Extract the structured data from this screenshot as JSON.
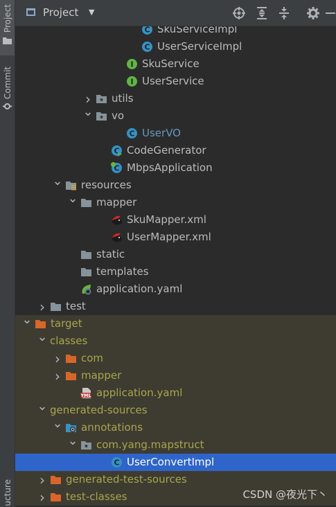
{
  "sidebar": {
    "project_label": "Project",
    "commit_label": "Commit",
    "structure_label": "ucture"
  },
  "header": {
    "title": "Project"
  },
  "tree": [
    {
      "label": "SkuServiceImpl",
      "icon": "class-icon",
      "style": "normal"
    },
    {
      "label": "UserServiceImpl",
      "icon": "class-icon",
      "style": "normal"
    },
    {
      "label": "SkuService",
      "icon": "interface-icon",
      "style": "normal"
    },
    {
      "label": "UserService",
      "icon": "interface-icon",
      "style": "normal"
    },
    {
      "label": "utils",
      "icon": "package-folder-icon",
      "style": "normal",
      "expanded": false
    },
    {
      "label": "vo",
      "icon": "package-folder-icon",
      "style": "normal",
      "expanded": true
    },
    {
      "label": "UserVO",
      "icon": "class-icon",
      "style": "blue"
    },
    {
      "label": "CodeGenerator",
      "icon": "class-runnable-icon",
      "style": "normal"
    },
    {
      "label": "MbpsApplication",
      "icon": "spring-class-icon",
      "style": "normal"
    },
    {
      "label": "resources",
      "icon": "resources-folder-icon",
      "style": "normal",
      "expanded": true
    },
    {
      "label": "mapper",
      "icon": "folder-icon",
      "style": "normal",
      "expanded": true
    },
    {
      "label": "SkuMapper.xml",
      "icon": "mybatis-xml-icon",
      "style": "normal"
    },
    {
      "label": "UserMapper.xml",
      "icon": "mybatis-xml-icon",
      "style": "normal"
    },
    {
      "label": "static",
      "icon": "folder-icon",
      "style": "normal"
    },
    {
      "label": "templates",
      "icon": "folder-icon",
      "style": "normal"
    },
    {
      "label": "application.yaml",
      "icon": "spring-yaml-icon",
      "style": "normal"
    },
    {
      "label": "test",
      "icon": "folder-icon",
      "style": "normal",
      "expanded": false
    },
    {
      "label": "target",
      "icon": "excluded-folder-icon",
      "style": "olive",
      "expanded": true
    },
    {
      "label": "classes",
      "icon": "",
      "style": "olive",
      "expanded": true
    },
    {
      "label": "com",
      "icon": "excluded-folder-icon",
      "style": "olive",
      "expanded": false
    },
    {
      "label": "mapper",
      "icon": "excluded-folder-icon",
      "style": "olive",
      "expanded": false
    },
    {
      "label": "application.yaml",
      "icon": "yml-file-icon",
      "style": "olive"
    },
    {
      "label": "generated-sources",
      "icon": "",
      "style": "olive",
      "expanded": true
    },
    {
      "label": "annotations",
      "icon": "generated-sources-folder-icon",
      "style": "olive",
      "expanded": true
    },
    {
      "label": "com.yang.mapstruct",
      "icon": "package-folder-icon",
      "style": "olive",
      "expanded": true
    },
    {
      "label": "UserConvertImpl",
      "icon": "class-icon",
      "style": "selected"
    },
    {
      "label": "generated-test-sources",
      "icon": "excluded-folder-icon",
      "style": "olive",
      "expanded": false
    },
    {
      "label": "test-classes",
      "icon": "excluded-folder-icon",
      "style": "olive",
      "expanded": false
    }
  ],
  "watermark": "CSDN @夜光下丶",
  "colors": {
    "background": "#2b2b2b",
    "panel": "#3c3f41",
    "excluded_row": "#3e3c31",
    "selected_row": "#2f65ca",
    "excluded_text": "#a6a64c",
    "class_icon": "#3592c4",
    "interface_icon": "#62b543",
    "excluded_folder": "#d9652b"
  }
}
